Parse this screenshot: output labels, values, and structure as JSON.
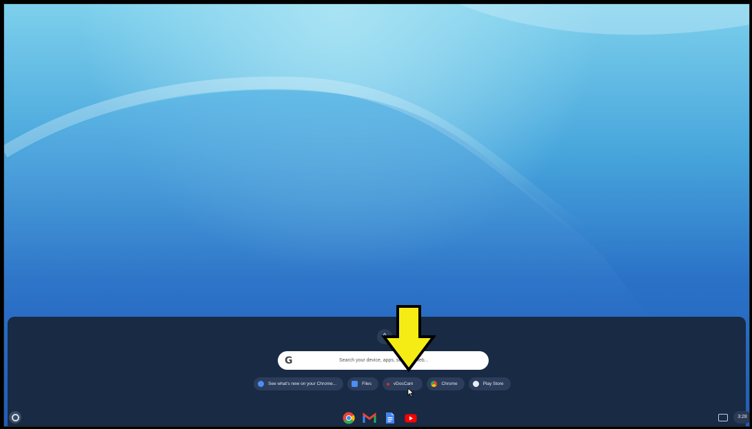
{
  "launcher": {
    "search_placeholder": "Search your device, apps, settings, web...",
    "expand_icon": "chevron-up-icon",
    "chips": [
      {
        "label": "See what's new on your Chrome...",
        "icon": "explore-icon",
        "color": "#4c8df6"
      },
      {
        "label": "Files",
        "icon": "files-icon",
        "color": "#4c8df6"
      },
      {
        "label": "vDocCam",
        "icon": "vdoccam-icon",
        "color": "#d93025"
      },
      {
        "label": "Chrome",
        "icon": "chrome-icon",
        "color": "#fbbc04"
      },
      {
        "label": "Play Store",
        "icon": "play-store-icon",
        "color": "#34a853"
      }
    ]
  },
  "shelf": {
    "apps": [
      "chrome-icon",
      "gmail-icon",
      "docs-icon",
      "youtube-icon"
    ],
    "time": "3:28"
  },
  "annotation": {
    "arrow_color": "#f5ec16"
  }
}
